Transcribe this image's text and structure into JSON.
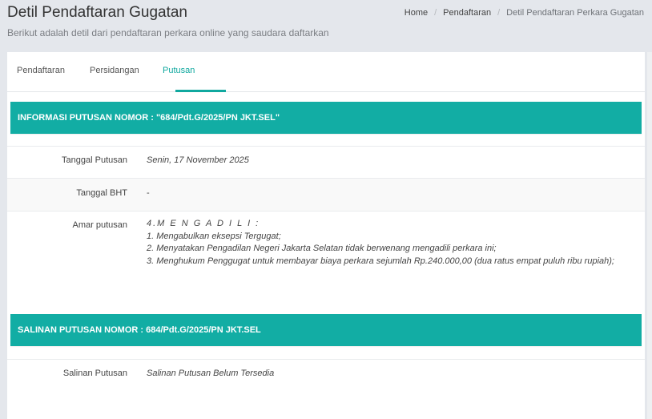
{
  "header": {
    "title": "Detil Pendaftaran Gugatan",
    "subtitle": "Berikut adalah detil dari pendaftaran perkara online yang saudara daftarkan"
  },
  "breadcrumb": {
    "home": "Home",
    "separator": "/",
    "pendaftaran": "Pendaftaran",
    "current": "Detil Pendaftaran Perkara Gugatan"
  },
  "tabs": [
    {
      "label": "Pendaftaran",
      "active": false
    },
    {
      "label": "Persidangan",
      "active": false
    },
    {
      "label": "Putusan",
      "active": true
    }
  ],
  "putusan": {
    "heading": "INFORMASI PUTUSAN NOMOR : \"684/Pdt.G/2025/PN JKT.SEL\"",
    "tanggal_putusan_label": "Tanggal Putusan",
    "tanggal_putusan_value": "Senin, 17 November 2025",
    "tanggal_bht_label": "Tanggal BHT",
    "tanggal_bht_value": "-",
    "amar_label": "Amar putusan",
    "amar_lines": [
      "4.M E N G A D I L I :",
      "1. Mengabulkan eksepsi Tergugat;",
      "2. Menyatakan Pengadilan Negeri Jakarta Selatan tidak berwenang mengadili perkara ini;",
      "3. Menghukum Penggugat untuk membayar biaya perkara sejumlah Rp.240.000,00 (dua ratus empat puluh ribu rupiah);"
    ]
  },
  "salinan": {
    "heading": "SALINAN PUTUSAN NOMOR : 684/Pdt.G/2025/PN JKT.SEL",
    "label": "Salinan Putusan",
    "value": "Salinan Putusan Belum Tersedia"
  },
  "colors": {
    "accent": "#12ada4",
    "tab_active": "#10a89f",
    "background": "#e4e7ec"
  }
}
